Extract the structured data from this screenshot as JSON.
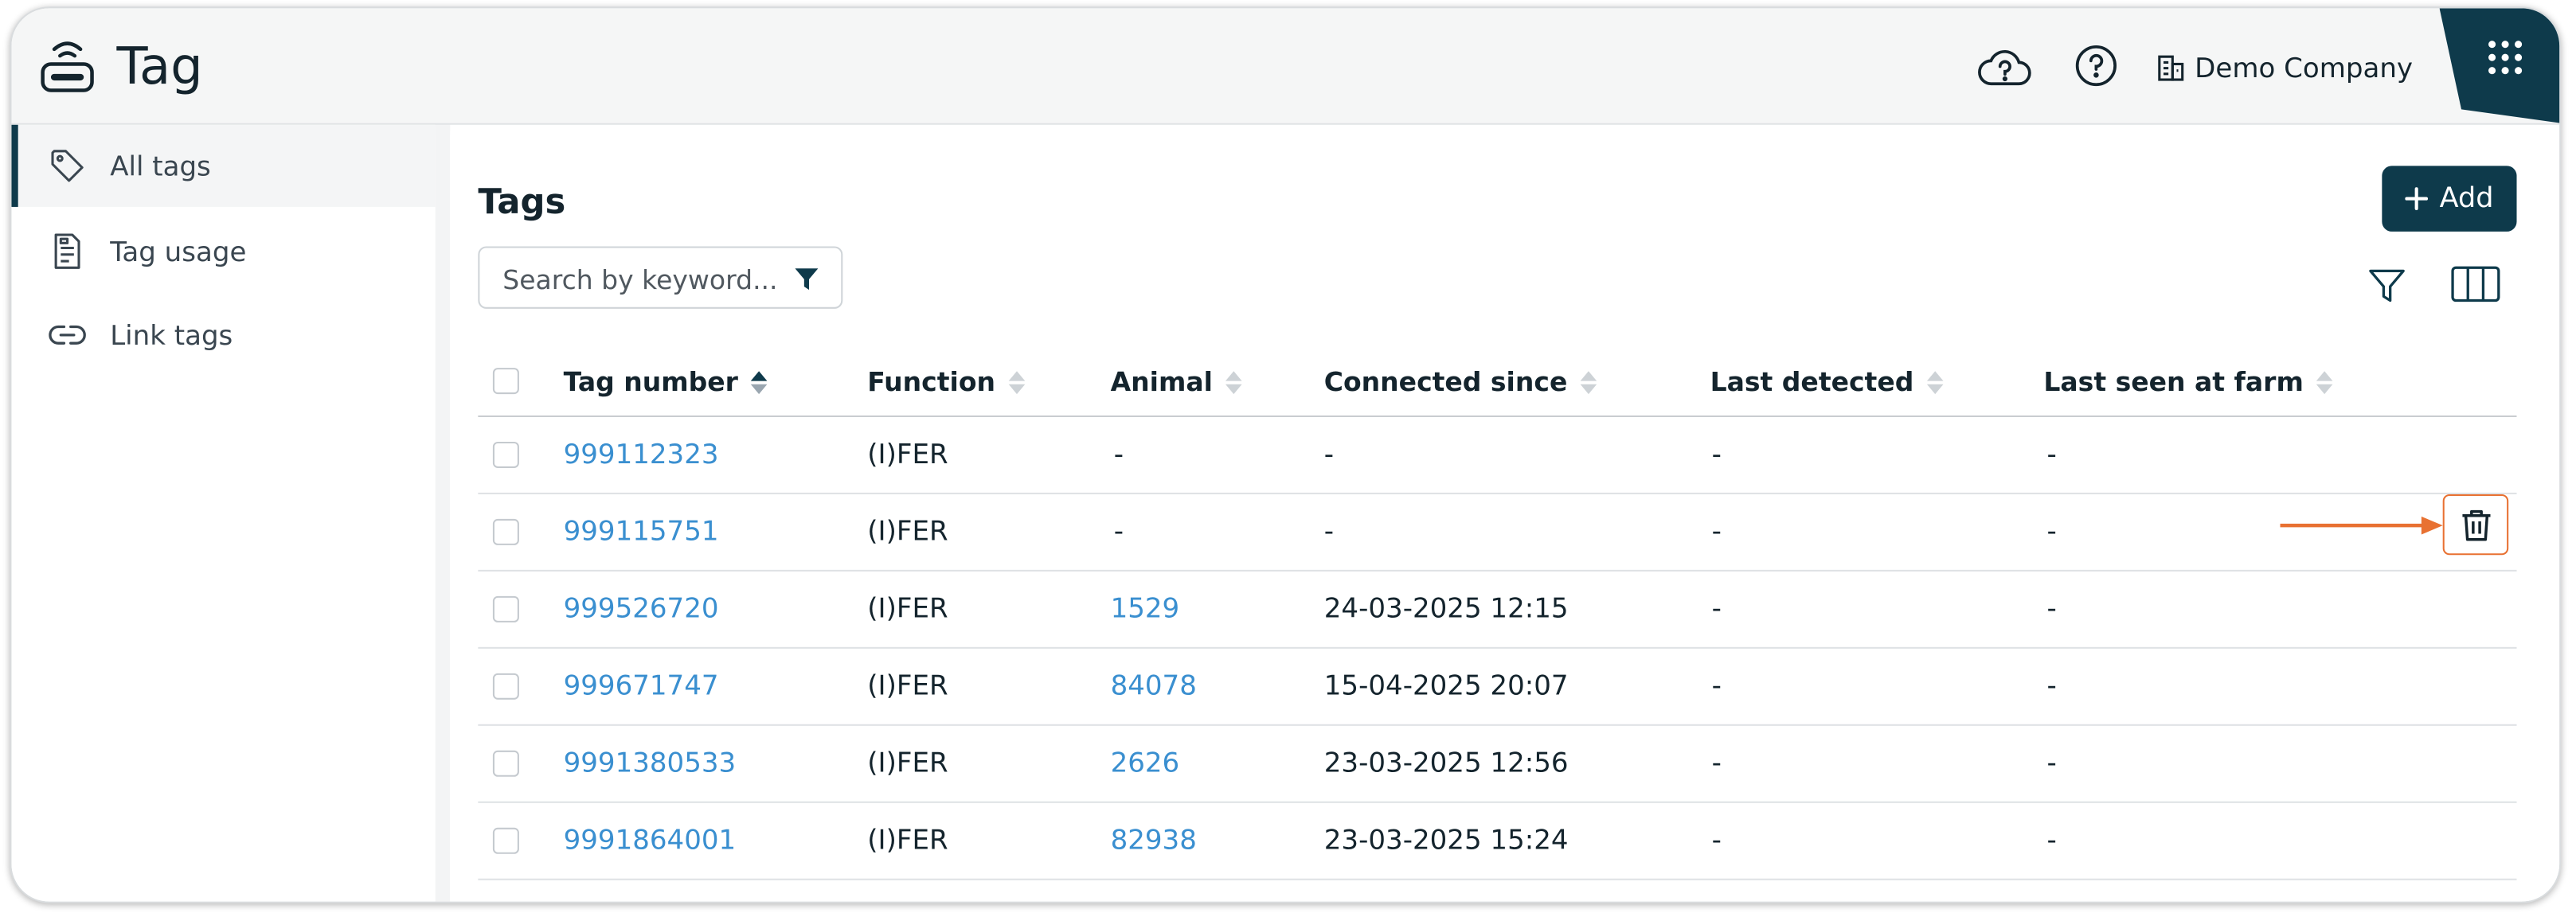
{
  "app": {
    "title": "Tag",
    "company": "Demo Company"
  },
  "sidebar": {
    "items": [
      {
        "label": "All tags",
        "icon": "tag-icon",
        "active": true
      },
      {
        "label": "Tag usage",
        "icon": "document-icon",
        "active": false
      },
      {
        "label": "Link tags",
        "icon": "link-icon",
        "active": false
      }
    ]
  },
  "main": {
    "title": "Tags",
    "add_label": "Add",
    "search": {
      "placeholder": "Search by keyword...",
      "value": ""
    }
  },
  "table": {
    "columns": [
      "Tag number",
      "Function",
      "Animal",
      "Connected since",
      "Last detected",
      "Last seen at farm"
    ],
    "sorted_column": "Tag number",
    "rows": [
      {
        "tag": "999112323",
        "function": "(I)FER",
        "animal": "-",
        "connected": "-",
        "last_detected": "-",
        "last_seen": "-"
      },
      {
        "tag": "999115751",
        "function": "(I)FER",
        "animal": "-",
        "connected": "-",
        "last_detected": "-",
        "last_seen": "-"
      },
      {
        "tag": "999526720",
        "function": "(I)FER",
        "animal": "1529",
        "connected": "24-03-2025 12:15",
        "last_detected": "-",
        "last_seen": "-"
      },
      {
        "tag": "999671747",
        "function": "(I)FER",
        "animal": "84078",
        "connected": "15-04-2025 20:07",
        "last_detected": "-",
        "last_seen": "-"
      },
      {
        "tag": "9991380533",
        "function": "(I)FER",
        "animal": "2626",
        "connected": "23-03-2025 12:56",
        "last_detected": "-",
        "last_seen": "-"
      },
      {
        "tag": "9991864001",
        "function": "(I)FER",
        "animal": "82938",
        "connected": "23-03-2025 15:24",
        "last_detected": "-",
        "last_seen": "-"
      }
    ]
  },
  "colors": {
    "brand": "#0e3a4b",
    "link": "#3a8fd0",
    "highlight": "#e87132"
  }
}
